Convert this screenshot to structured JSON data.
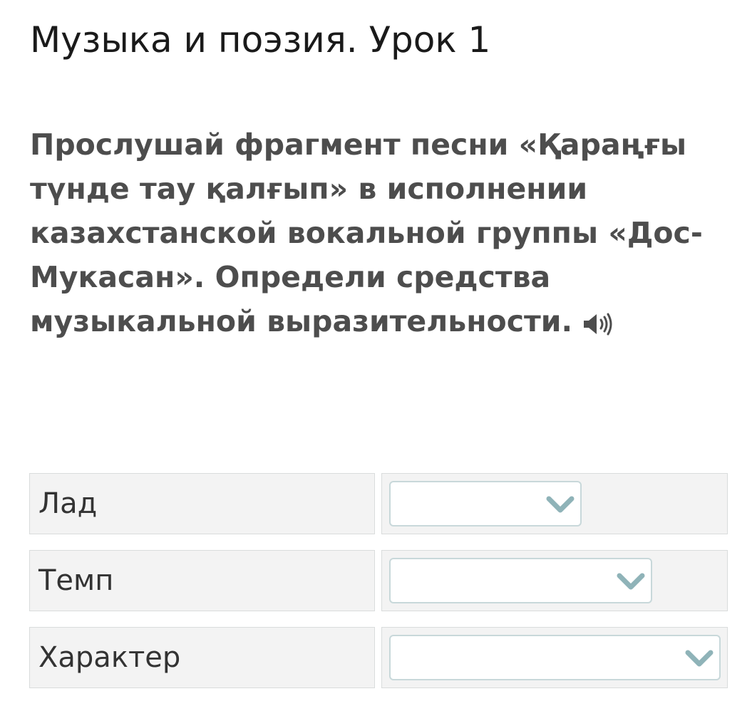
{
  "header": {
    "title": "Музыка и поэзия. Урок 1"
  },
  "question": {
    "text": "Прослушай фрагмент песни «Қараңғы түнде тау қалғып» в исполнении казахстанской вокальной группы «Дос-Мукасан». Определи средства музыкальной выразительности.",
    "audio_icon": "speaker-icon"
  },
  "rows": [
    {
      "label": "Лад",
      "selected": "",
      "icon": "chevron-down-icon"
    },
    {
      "label": "Темп",
      "selected": "",
      "icon": "chevron-down-icon"
    },
    {
      "label": "Характер",
      "selected": "",
      "icon": "chevron-down-icon"
    }
  ],
  "colors": {
    "question_text": "#4d4d4d",
    "cell_background": "#f3f3f3",
    "select_border": "#c8d8da",
    "chevron": "#8fb3b8"
  }
}
